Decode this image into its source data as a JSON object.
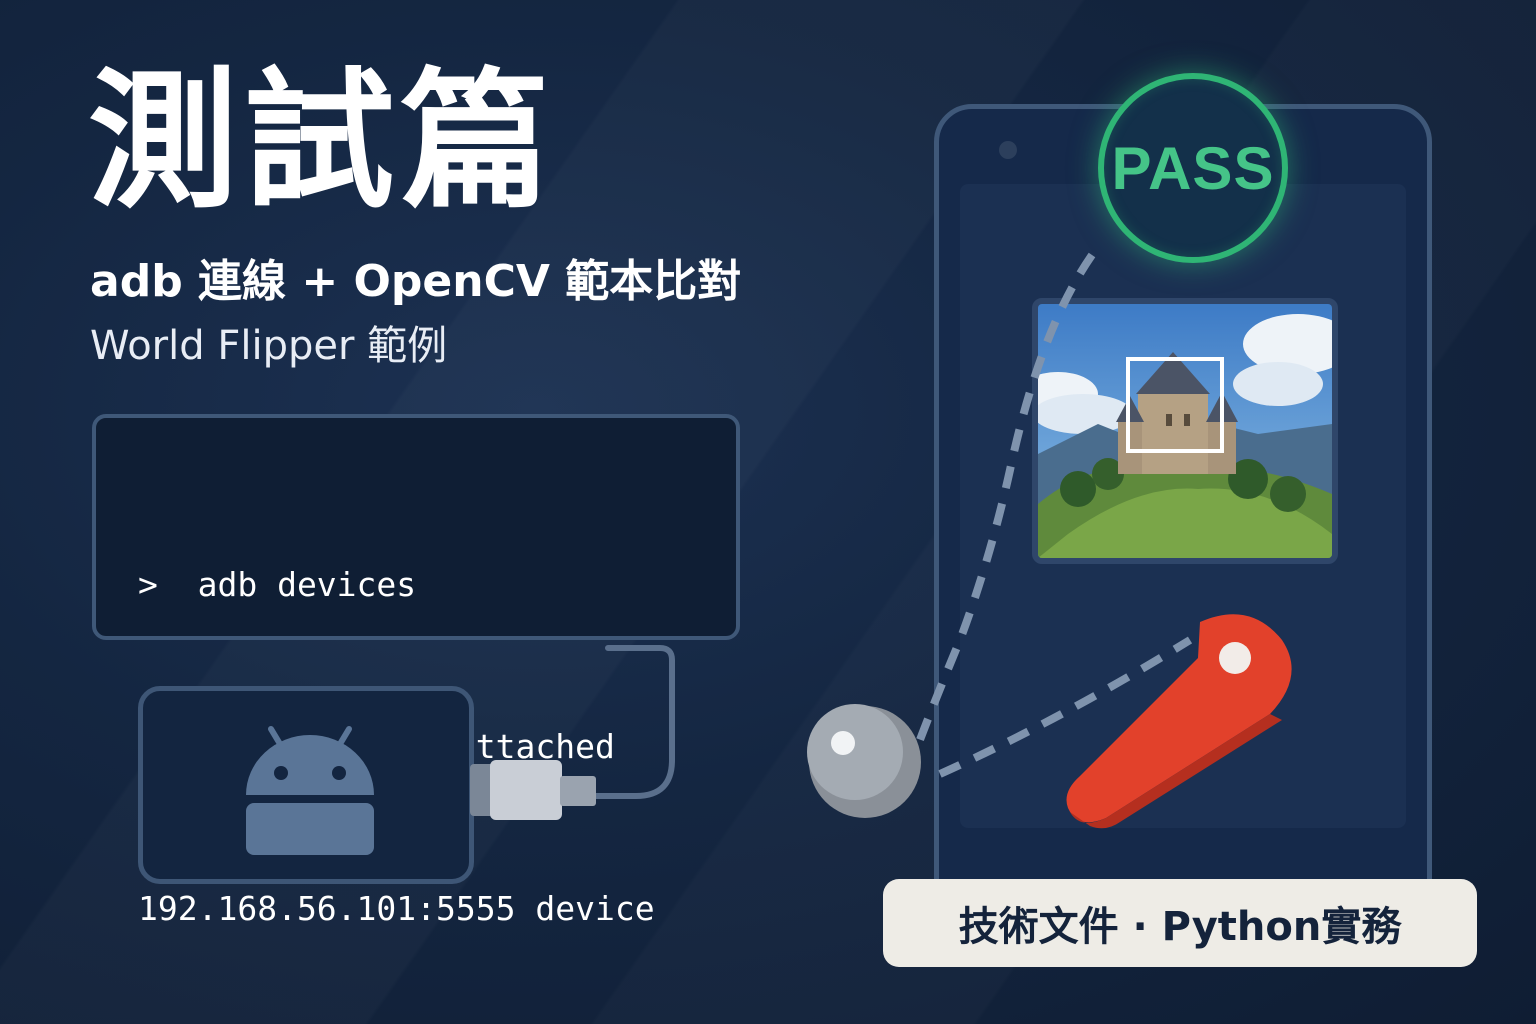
{
  "header": {
    "title": "測試篇",
    "subtitle": "adb 連線 + OpenCV 範本比對",
    "example": "World Flipper 範例"
  },
  "terminal": {
    "lines": [
      ">  adb devices",
      "List of devices attached",
      "192.168.56.101:5555 device"
    ]
  },
  "status": {
    "pass_label": "PASS"
  },
  "footer": {
    "badge": "技術文件 · Python實務"
  },
  "colors": {
    "background": "#142641",
    "pass_green": "#2fb575",
    "flipper_red": "#e2412b",
    "badge_bg": "#eeece6"
  },
  "icons": [
    "android-icon",
    "usb-plug-icon",
    "pinball-icon",
    "flipper-icon",
    "camera-dot-icon"
  ]
}
